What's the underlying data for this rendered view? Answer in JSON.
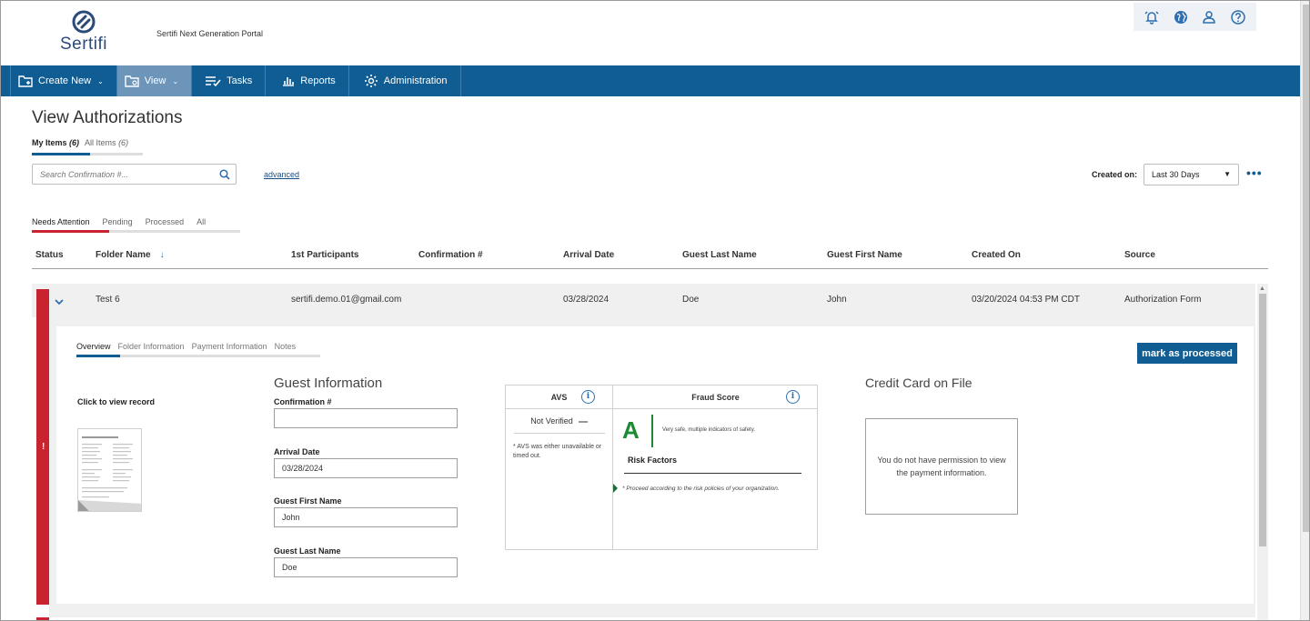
{
  "header": {
    "logo_text": "Sertifi",
    "portal_title": "Sertifi Next Generation Portal"
  },
  "top_icons": [
    "alarm-bell-icon",
    "globe-icon",
    "user-icon",
    "help-icon"
  ],
  "nav": {
    "create_new": "Create New",
    "view": "View",
    "tasks": "Tasks",
    "reports": "Reports",
    "administration": "Administration"
  },
  "page": {
    "title": "View Authorizations",
    "my_items": "My Items",
    "my_items_count": "(6)",
    "all_items": "All Items",
    "all_items_count": "(6)",
    "search_placeholder": "Search Confirmation #...",
    "advanced": "advanced",
    "created_on_label": "Created on:",
    "created_on_value": "Last 30 Days",
    "more": "•••"
  },
  "status_tabs": {
    "needs_attention": "Needs Attention",
    "pending": "Pending",
    "processed": "Processed",
    "all": "All"
  },
  "table": {
    "headers": {
      "status": "Status",
      "folder_name": "Folder Name",
      "participants": "1st Participants",
      "confirmation": "Confirmation #",
      "arrival": "Arrival Date",
      "last_name": "Guest Last Name",
      "first_name": "Guest First Name",
      "created_on": "Created On",
      "source": "Source"
    },
    "sort_arrow": "↓",
    "row": {
      "status_mark": "!",
      "folder_name": "Test 6",
      "participants": "sertifi.demo.01@gmail.com",
      "confirmation": "",
      "arrival": "03/28/2024",
      "last_name": "Doe",
      "first_name": "John",
      "created_on": "03/20/2024 04:53 PM CDT",
      "source": "Authorization Form"
    }
  },
  "detail": {
    "tabs": {
      "overview": "Overview",
      "folder_information": "Folder Information",
      "payment_information": "Payment Information",
      "notes": "Notes"
    },
    "mark_processed": "mark as processed",
    "click_to_view": "Click to view record",
    "guest_title": "Guest Information",
    "confirmation_label": "Confirmation #",
    "confirmation_value": "",
    "arrival_label": "Arrival Date",
    "arrival_value": "03/28/2024",
    "first_label": "Guest First Name",
    "first_value": "John",
    "last_label": "Guest Last Name",
    "last_value": "Doe",
    "avs": {
      "title": "AVS",
      "value": "Not Verified",
      "note": "* AVS was either unavailable or timed out."
    },
    "fraud": {
      "title": "Fraud Score",
      "grade": "A",
      "grade_text": "Very safe, multiple indicators of safety.",
      "risk_title": "Risk Factors",
      "risk_note": "* Proceed according to the risk policies of your organization."
    },
    "cc_title": "Credit Card on File",
    "cc_message": "You do not have permission to view the payment information."
  },
  "colors": {
    "nav_bg": "#0f5d93",
    "nav_active": "#6d94b9",
    "attention_red": "#c8232f",
    "grade_green": "#1e8a36"
  }
}
